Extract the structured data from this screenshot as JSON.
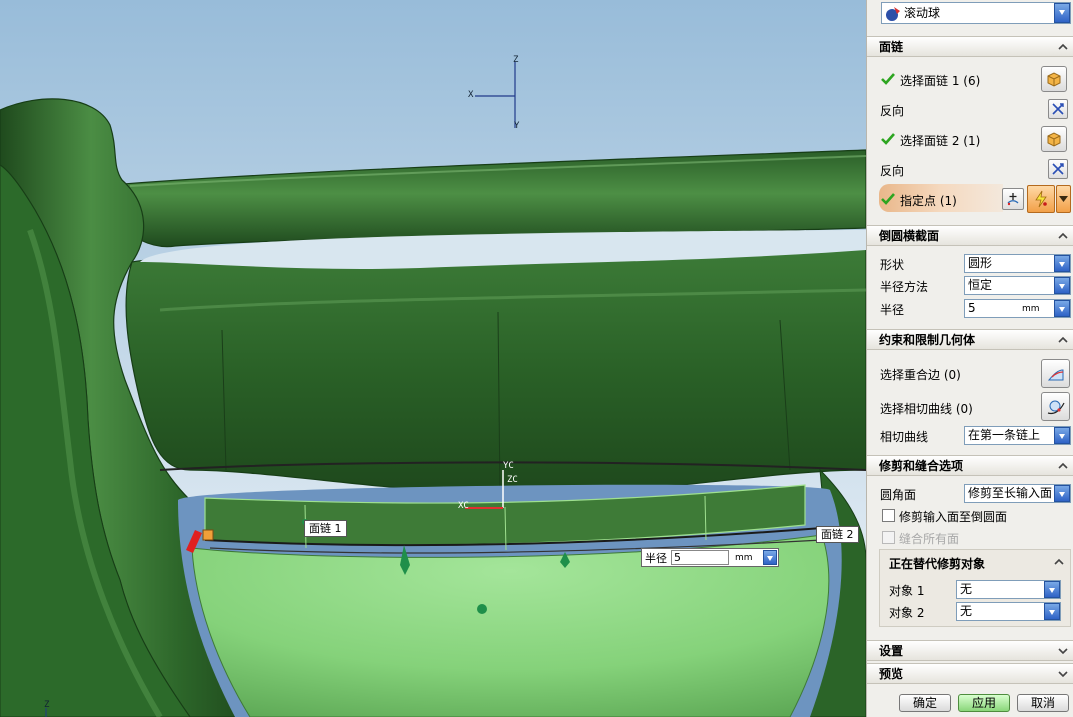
{
  "dialog": {
    "type_select": "滚动球",
    "sections": {
      "face_chain": "面链",
      "cross_section": "倒圆横截面",
      "constraint": "约束和限制几何体",
      "trim": "修剪和缝合选项",
      "settings": "设置",
      "preview": "预览"
    },
    "face_chain": {
      "select1": "选择面链 1 (6)",
      "reverse1": "反向",
      "select2": "选择面链 2 (1)",
      "reverse2": "反向",
      "point": "指定点 (1)"
    },
    "cross_section": {
      "shape_label": "形状",
      "shape_value": "圆形",
      "method_label": "半径方法",
      "method_value": "恒定",
      "radius_label": "半径",
      "radius_value": "5",
      "radius_unit": "mm"
    },
    "constraint": {
      "coincident_edge": "选择重合边 (0)",
      "tangent_curve": "选择相切曲线 (0)",
      "tangent_label": "相切曲线",
      "tangent_value": "在第一条链上"
    },
    "trim": {
      "fillet_label": "圆角面",
      "fillet_value": "修剪至长输入面",
      "trim_inputs": "修剪输入面至倒圆面",
      "sew_all": "缝合所有面",
      "override_title": "正在替代修剪对象",
      "obj1_label": "对象 1",
      "obj1_value": "无",
      "obj2_label": "对象 2",
      "obj2_value": "无"
    },
    "buttons": {
      "ok": "确定",
      "apply": "应用",
      "cancel": "取消"
    }
  },
  "viewport": {
    "tag_chain1": "面链 1",
    "tag_chain2": "面链 2",
    "radius_label": "半径",
    "radius_value": "5",
    "radius_unit": "mm",
    "axis_labels": {
      "z": "Z",
      "x": "X",
      "y": "Y",
      "yc": "YC",
      "zc": "ZC",
      "xc": "XC"
    }
  },
  "colors": {
    "sky_top": "#9fc1dc",
    "sky_bottom": "#eef4f8",
    "part_green": "#2f6b2c",
    "highlight_green": "#8fd884",
    "accent_orange": "#f0a03a"
  }
}
